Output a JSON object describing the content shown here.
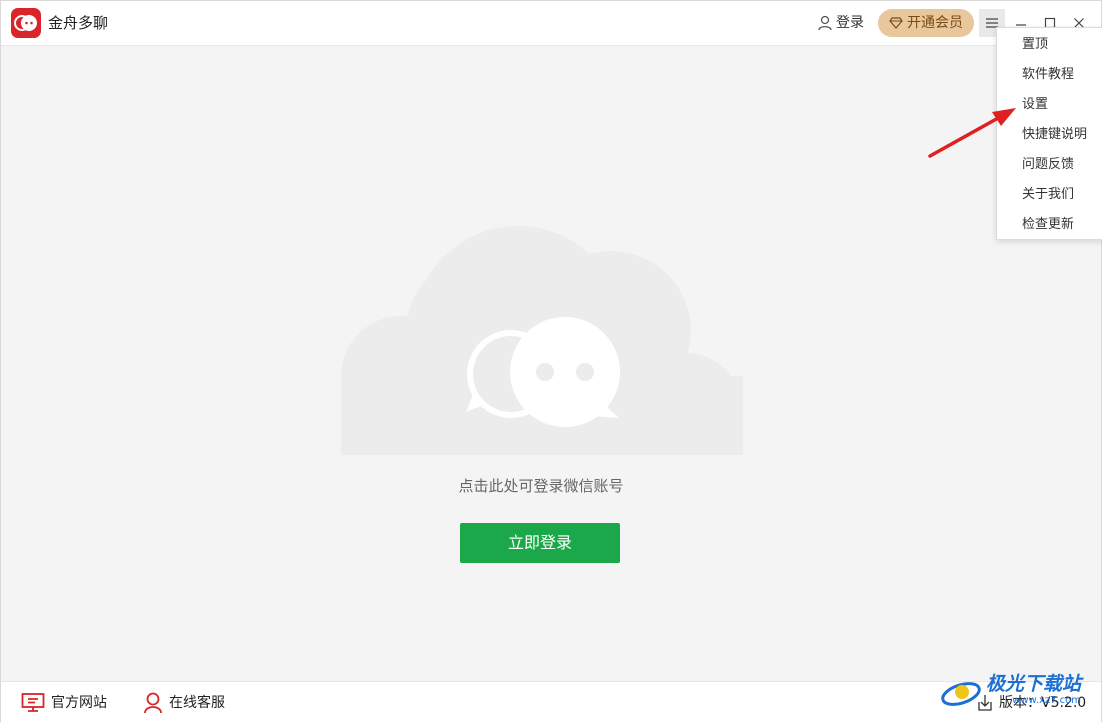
{
  "app": {
    "title": "金舟多聊"
  },
  "header": {
    "login_label": "登录",
    "vip_label": "开通会员",
    "menu_label": "☰"
  },
  "menu": {
    "items": [
      "置顶",
      "软件教程",
      "设置",
      "快捷键说明",
      "问题反馈",
      "关于我们",
      "检查更新"
    ],
    "highlighted_item": "设置"
  },
  "main": {
    "hint": "点击此处可登录微信账号",
    "login_button": "立即登录"
  },
  "footer": {
    "site_label": "官方网站",
    "service_label": "在线客服",
    "version": "版本：V5.2.0"
  },
  "watermark": {
    "name": "极光下载站",
    "url": "www.xz7.com"
  },
  "colors": {
    "brand_red": "#d9242a",
    "login_green": "#1aa84a",
    "vip_gold": "#e9c79c",
    "arrow_red": "#e02020",
    "cloud_gray": "#ececec"
  }
}
